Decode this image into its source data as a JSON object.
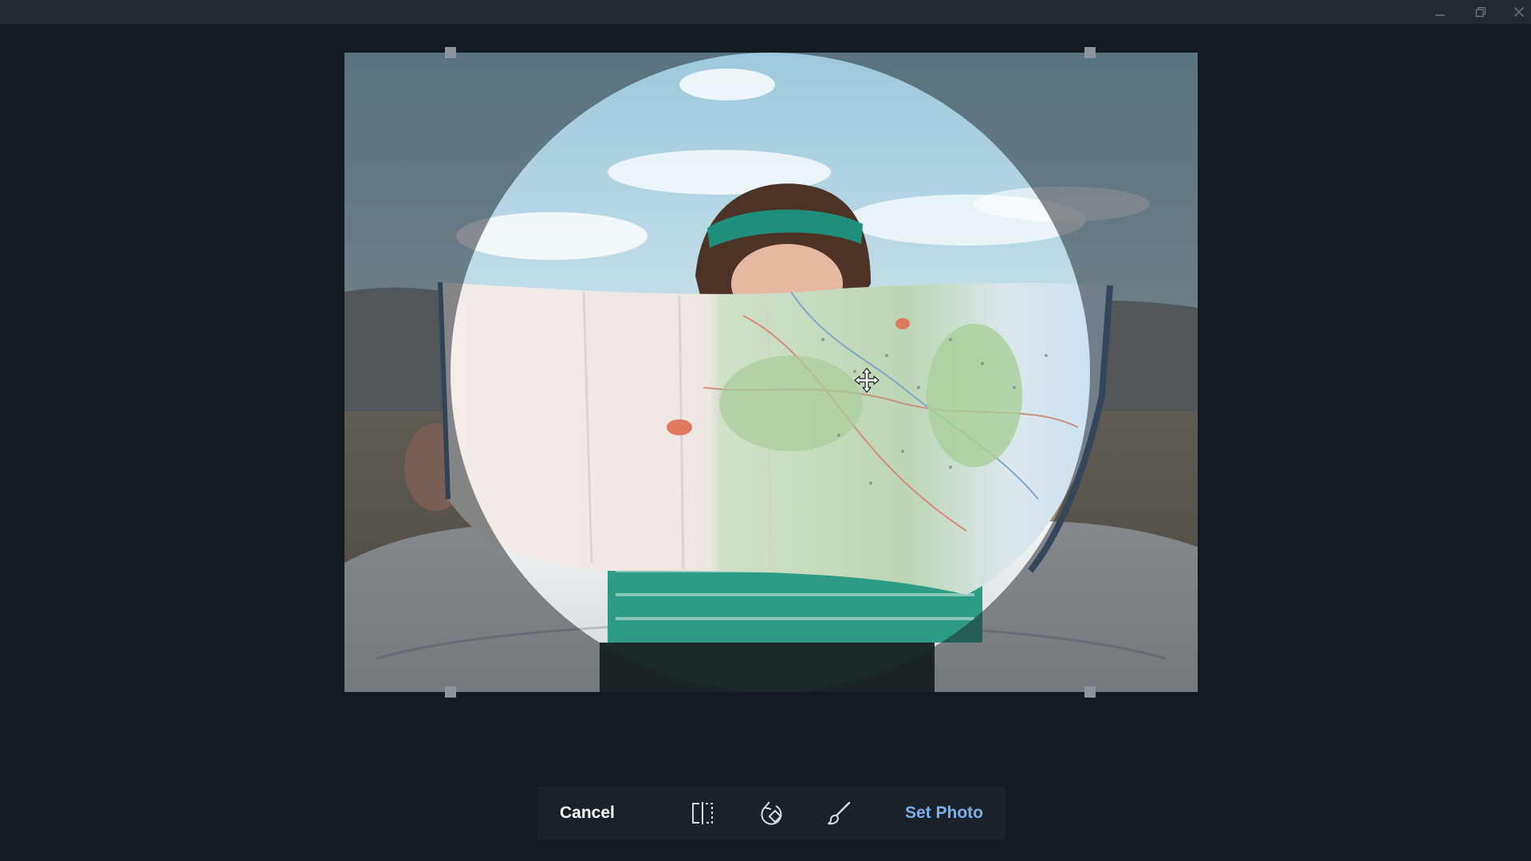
{
  "window": {
    "controls": {
      "minimize_icon": "minimize-icon",
      "maximize_icon": "restore-icon",
      "close_icon": "close-icon"
    }
  },
  "editor": {
    "crop_shape": "circle",
    "image_subject": "person-holding-map",
    "move_cursor_icon": "move-icon"
  },
  "toolbar": {
    "cancel_label": "Cancel",
    "flip_icon": "flip-horizontal-icon",
    "rotate_icon": "rotate-icon",
    "brush_icon": "brush-icon",
    "set_photo_label": "Set Photo"
  },
  "colors": {
    "background": "#141a21",
    "titlebar": "#232a32",
    "toolbar": "#1b2128",
    "accent": "#7ab0ee",
    "handle": "#8d949c"
  }
}
